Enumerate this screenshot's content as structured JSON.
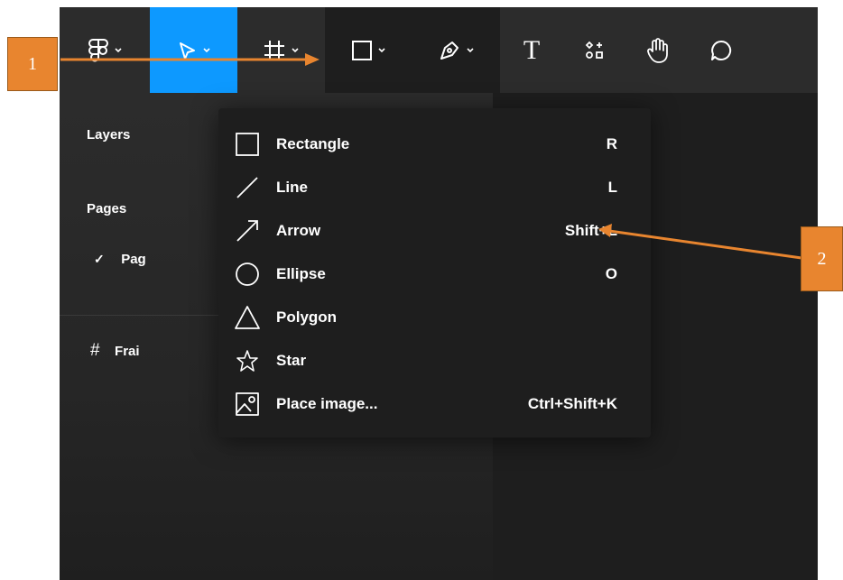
{
  "toolbar": {
    "tools": [
      {
        "name": "main-menu",
        "icon": "figma-logo-icon"
      },
      {
        "name": "move",
        "icon": "cursor-arrow-icon",
        "state": "selected"
      },
      {
        "name": "frame",
        "icon": "frame-icon"
      },
      {
        "name": "shape",
        "icon": "rectangle-icon",
        "state": "open"
      },
      {
        "name": "pen",
        "icon": "pen-icon"
      },
      {
        "name": "text",
        "icon": "text-icon"
      },
      {
        "name": "resources",
        "icon": "resources-icon"
      },
      {
        "name": "hand",
        "icon": "hand-icon"
      },
      {
        "name": "comment",
        "icon": "comment-icon"
      }
    ],
    "text_icon_glyph": "T"
  },
  "sidebar": {
    "layers_label": "Layers",
    "pages_label": "Pages",
    "page_item": "Pag",
    "frame_item": "Frai",
    "check_glyph": "✓",
    "hash_glyph": "#"
  },
  "shape_menu": {
    "items": [
      {
        "label": "Rectangle",
        "shortcut": "R",
        "icon": "rectangle-icon"
      },
      {
        "label": "Line",
        "shortcut": "L",
        "icon": "line-icon"
      },
      {
        "label": "Arrow",
        "shortcut": "Shift+L",
        "icon": "arrow-icon"
      },
      {
        "label": "Ellipse",
        "shortcut": "O",
        "icon": "ellipse-icon"
      },
      {
        "label": "Polygon",
        "shortcut": "",
        "icon": "polygon-icon"
      },
      {
        "label": "Star",
        "shortcut": "",
        "icon": "star-icon"
      },
      {
        "label": "Place image...",
        "shortcut": "Ctrl+Shift+K",
        "icon": "image-icon"
      }
    ]
  },
  "annotations": {
    "callout_1": "1",
    "callout_2": "2"
  },
  "colors": {
    "accent_selected": "#0d99ff",
    "callout_orange": "#e8852f",
    "menu_background": "#1e1e1e",
    "toolbar_background": "#2c2c2c"
  }
}
